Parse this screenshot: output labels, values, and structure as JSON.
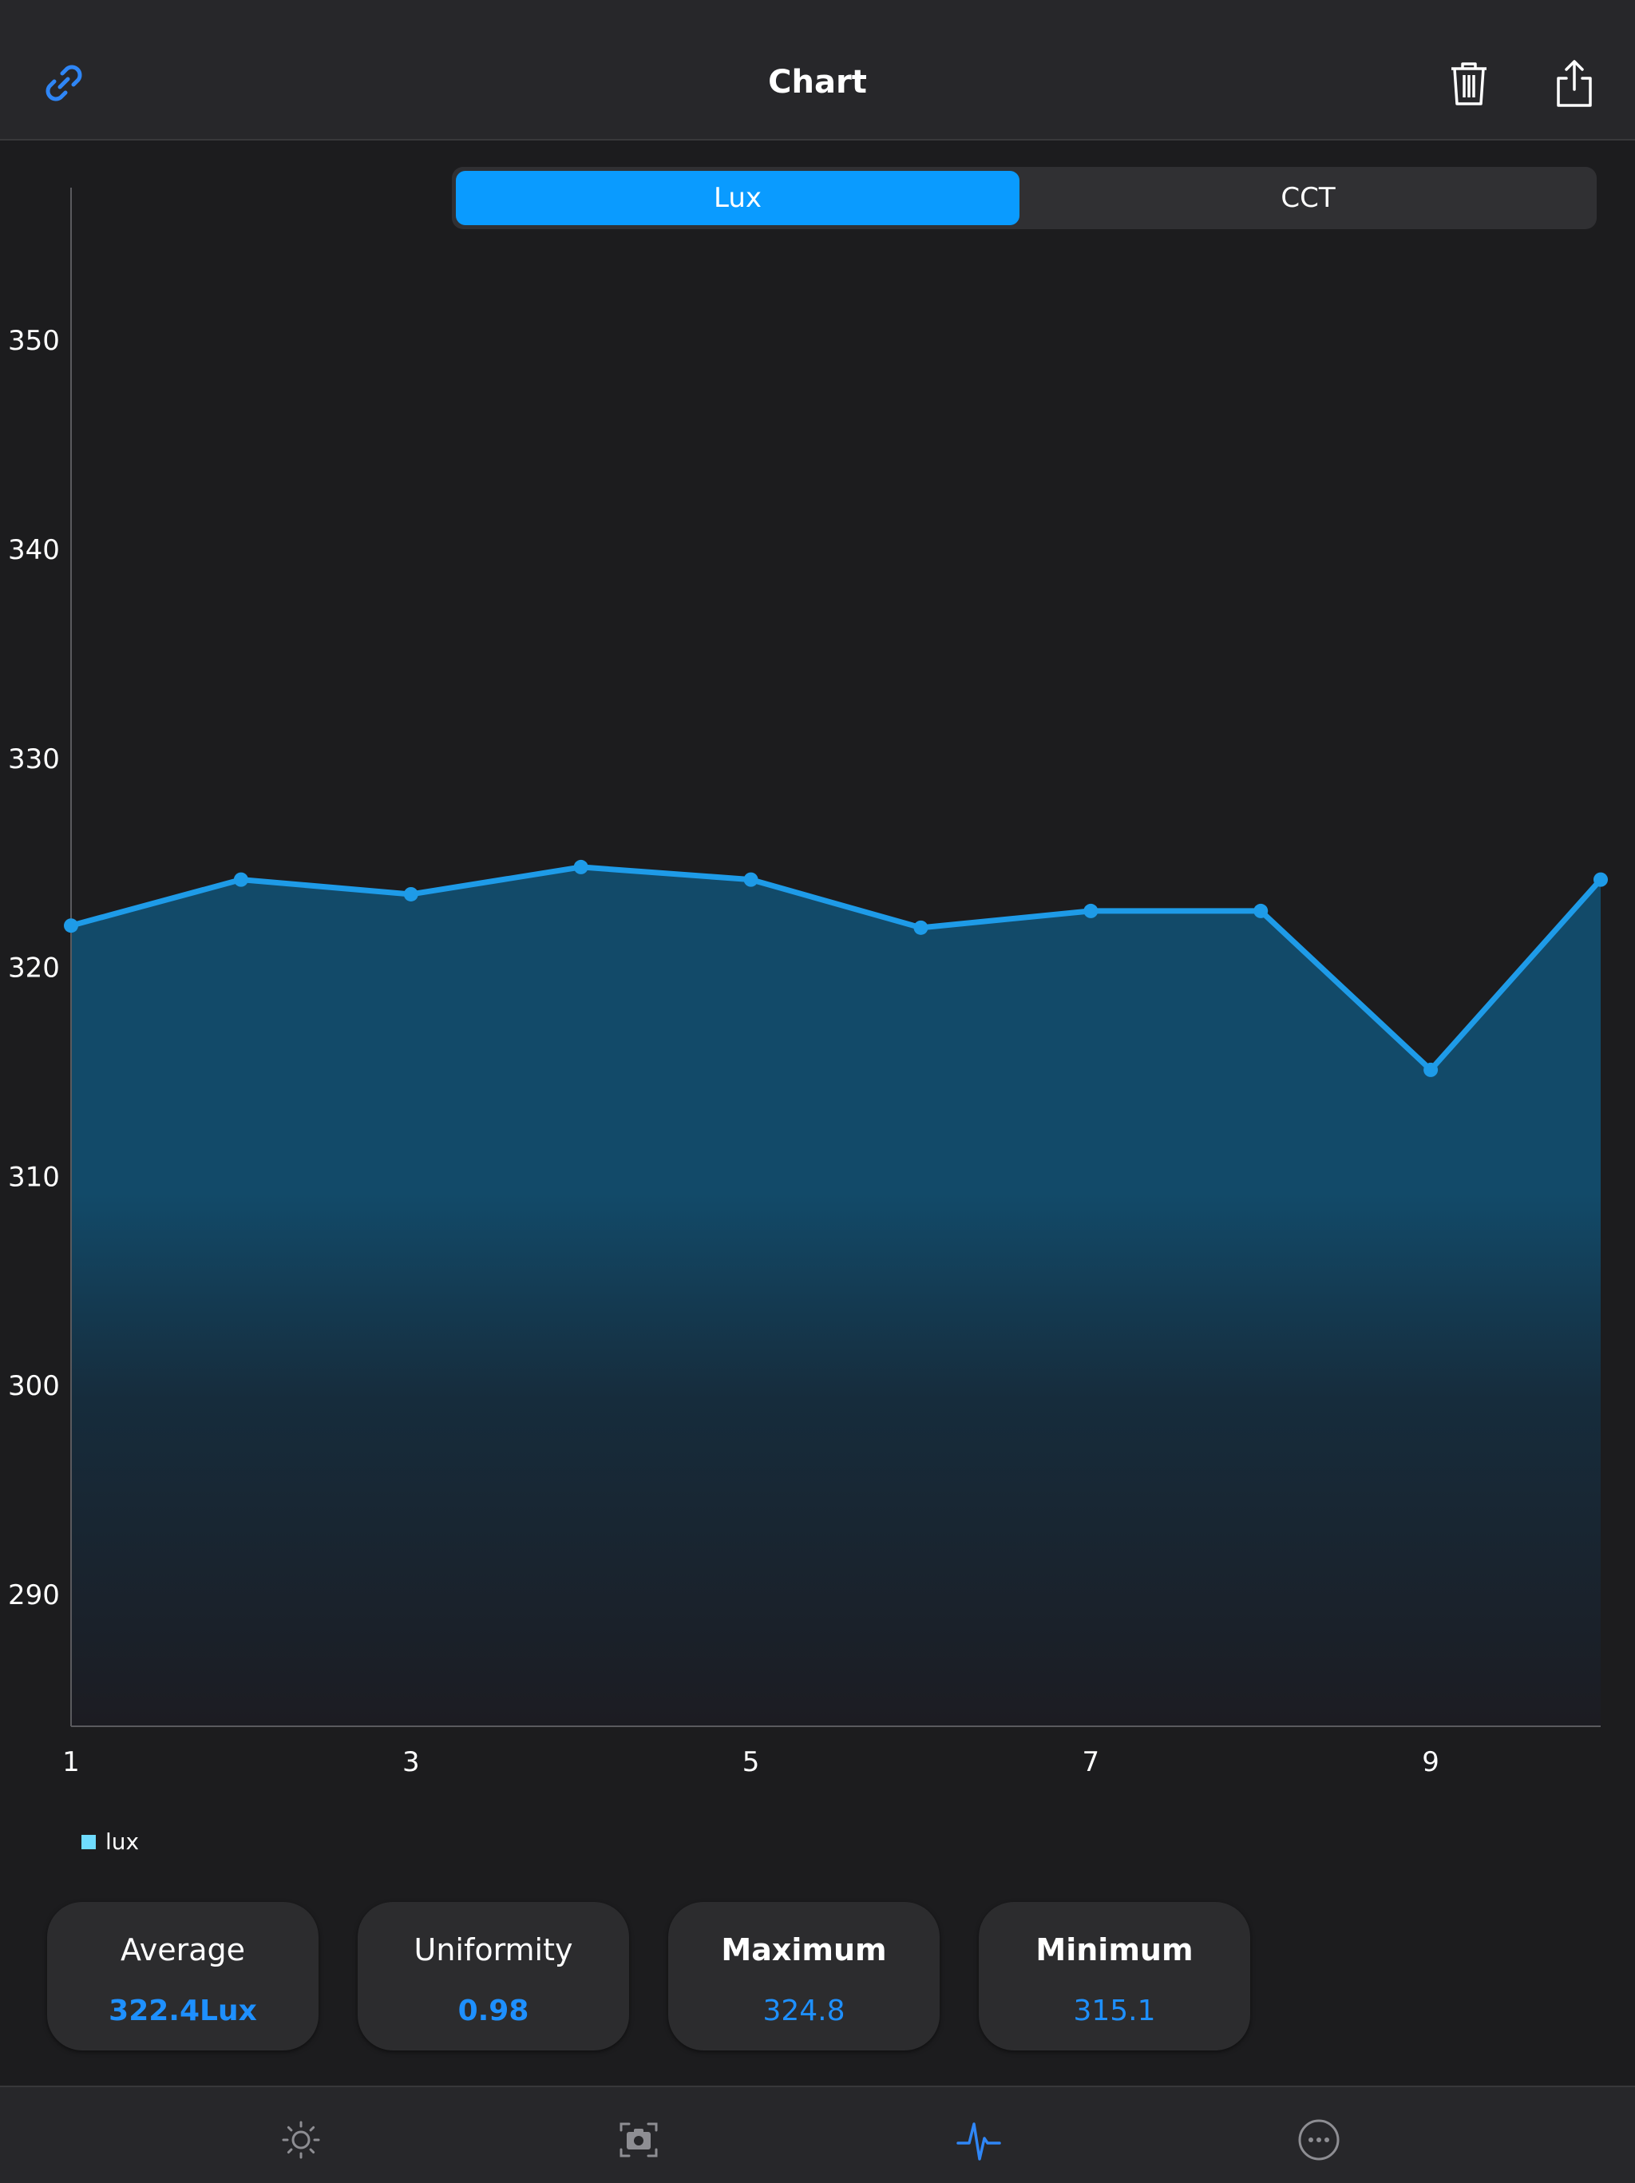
{
  "header": {
    "title": "Chart"
  },
  "segment": {
    "options": [
      "Lux",
      "CCT"
    ],
    "selected": "Lux"
  },
  "icons": {
    "link": "link-icon",
    "trash": "trash-icon",
    "share": "share-icon",
    "tab_light": "sun-icon",
    "tab_camera": "camera-icon",
    "tab_chart": "pulse-icon",
    "tab_more": "more-icon"
  },
  "colors": {
    "accent": "#0a9bff",
    "line": "#1e9be8",
    "value_text": "#1e90ff",
    "legend_swatch": "#6fdcff",
    "background": "#1c1c1e"
  },
  "chart_data": {
    "type": "area",
    "x": [
      1,
      2,
      3,
      4,
      5,
      6,
      7,
      8,
      9,
      10
    ],
    "series": [
      {
        "name": "lux",
        "values": [
          322.0,
          324.2,
          323.5,
          324.8,
          324.2,
          321.9,
          322.7,
          322.7,
          315.1,
          324.2
        ]
      }
    ],
    "x_ticks": [
      1,
      3,
      5,
      7,
      9
    ],
    "y_ticks": [
      290,
      300,
      310,
      320,
      330,
      340,
      350
    ],
    "xlim": [
      1,
      10
    ],
    "ylim": [
      283.7,
      357.3
    ],
    "grid": false,
    "legend_position": "bottom-left"
  },
  "stats": [
    {
      "label": "Average",
      "value": "322.4Lux"
    },
    {
      "label": "Uniformity",
      "value": "0.98"
    },
    {
      "label": "Maximum",
      "value": "324.8"
    },
    {
      "label": "Minimum",
      "value": "315.1"
    }
  ]
}
